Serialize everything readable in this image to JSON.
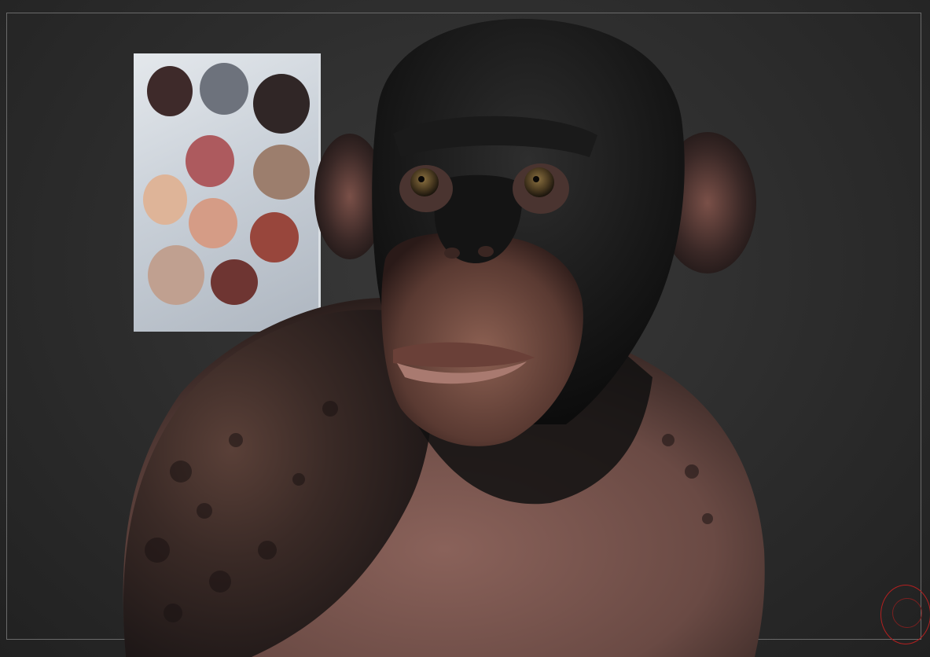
{
  "viewport": {
    "background_color": "#2c2c2c",
    "frame_color": "#6a6a6a"
  },
  "reference_card": {
    "swatches": [
      {
        "name": "dark-brown",
        "color": "#3e2a2a"
      },
      {
        "name": "slate-gray",
        "color": "#6d727c"
      },
      {
        "name": "charcoal-brown",
        "color": "#302626"
      },
      {
        "name": "rose",
        "color": "#ad5a5e"
      },
      {
        "name": "taupe",
        "color": "#9c7e6d"
      },
      {
        "name": "peach",
        "color": "#deb498"
      },
      {
        "name": "light-salmon",
        "color": "#d59c86"
      },
      {
        "name": "rust",
        "color": "#98463c"
      },
      {
        "name": "beige",
        "color": "#c0a090"
      },
      {
        "name": "maroon",
        "color": "#6e3532"
      }
    ]
  },
  "model": {
    "subject": "chimpanzee bust",
    "skin_dark": "#1a1a1a",
    "skin_light": "#8a6055",
    "eye_color": "#4a3a20"
  },
  "gizmo": {
    "icon": "navigation-gizmo-icon",
    "color": "#b32020"
  }
}
